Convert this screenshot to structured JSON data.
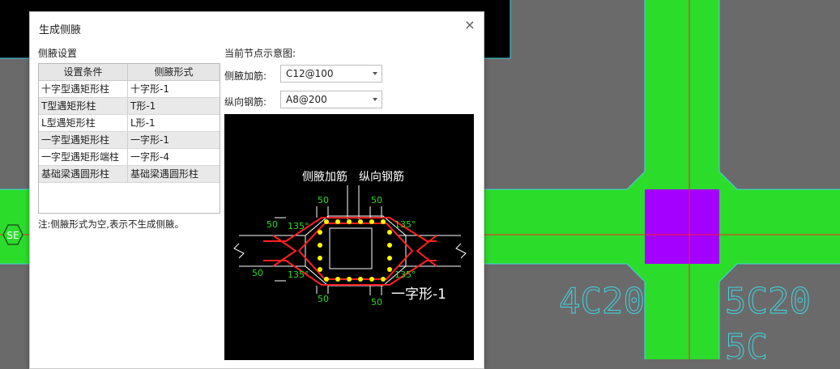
{
  "dialog": {
    "title": "生成侧腋",
    "close_label": "×",
    "settings_label": "侧腋设置",
    "diagram_label": "当前节点示意图:",
    "note": "注:侧腋形式为空,表示不生成侧腋。"
  },
  "table": {
    "headers": [
      "设置条件",
      "侧腋形式"
    ],
    "rows": [
      {
        "condition": "十字型遇矩形柱",
        "form": "十字形-1"
      },
      {
        "condition": "T型遇矩形柱",
        "form": "T形-1"
      },
      {
        "condition": "L型遇矩形柱",
        "form": "L形-1"
      },
      {
        "condition": "一字型遇矩形柱",
        "form": "一字形-1"
      },
      {
        "condition": "一字型遇矩形端柱",
        "form": "一字形-4"
      },
      {
        "condition": "基础梁遇圆形柱",
        "form": "基础梁遇圆形柱"
      }
    ]
  },
  "fields": {
    "haunch_rebar_label": "侧腋加筋:",
    "haunch_rebar_value": "C12@100",
    "long_rebar_label": "纵向钢筋:",
    "long_rebar_value": "A8@200"
  },
  "diagram": {
    "label_haunch": "侧腋加筋",
    "label_long": "纵向钢筋",
    "dim_50": "50",
    "angle_135": "135°",
    "name": "一字形-1"
  },
  "cad": {
    "text_left": "4C20",
    "text_right": "5C20",
    "text_bottom": "5C",
    "marker": "SE"
  },
  "colors": {
    "cad_bg": "#6a6a6a",
    "beam_green": "#2bdc2b",
    "column_purple": "#a300ff",
    "axis_red": "#ff2020",
    "cyan_outline": "#3fd7e6",
    "dim_green": "#2bdc2b",
    "rebar_yellow": "#ffff00",
    "haunch_red": "#ff2020"
  }
}
